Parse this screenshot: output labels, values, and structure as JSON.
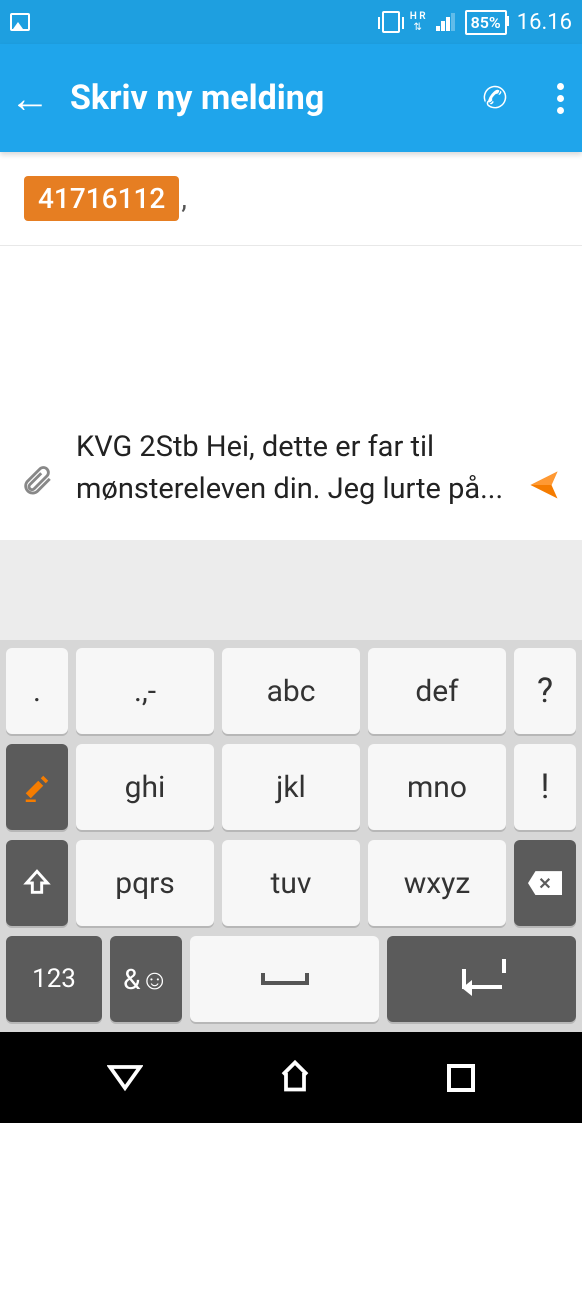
{
  "status": {
    "network_type": "H R",
    "battery": "85%",
    "time": "16.16"
  },
  "header": {
    "title": "Skriv ny melding"
  },
  "recipient": {
    "number": "41716112",
    "separator": ","
  },
  "compose": {
    "message": "KVG 2Stb Hei, dette er far til mønstereleven din. Jeg lurte på..."
  },
  "keyboard": {
    "row1": {
      "k1": ".",
      "k2": ".,-",
      "k3": "abc",
      "k4": "def",
      "k5": "?"
    },
    "row2": {
      "k1_icon": "edit",
      "k2": "ghi",
      "k3": "jkl",
      "k4": "mno",
      "k5": "!"
    },
    "row3": {
      "k1_icon": "shift",
      "k2": "pqrs",
      "k3": "tuv",
      "k4": "wxyz",
      "k5_icon": "backspace"
    },
    "row4": {
      "k1": "123",
      "k2": "&☺",
      "space_icon": "space",
      "enter_icon": "enter"
    }
  }
}
